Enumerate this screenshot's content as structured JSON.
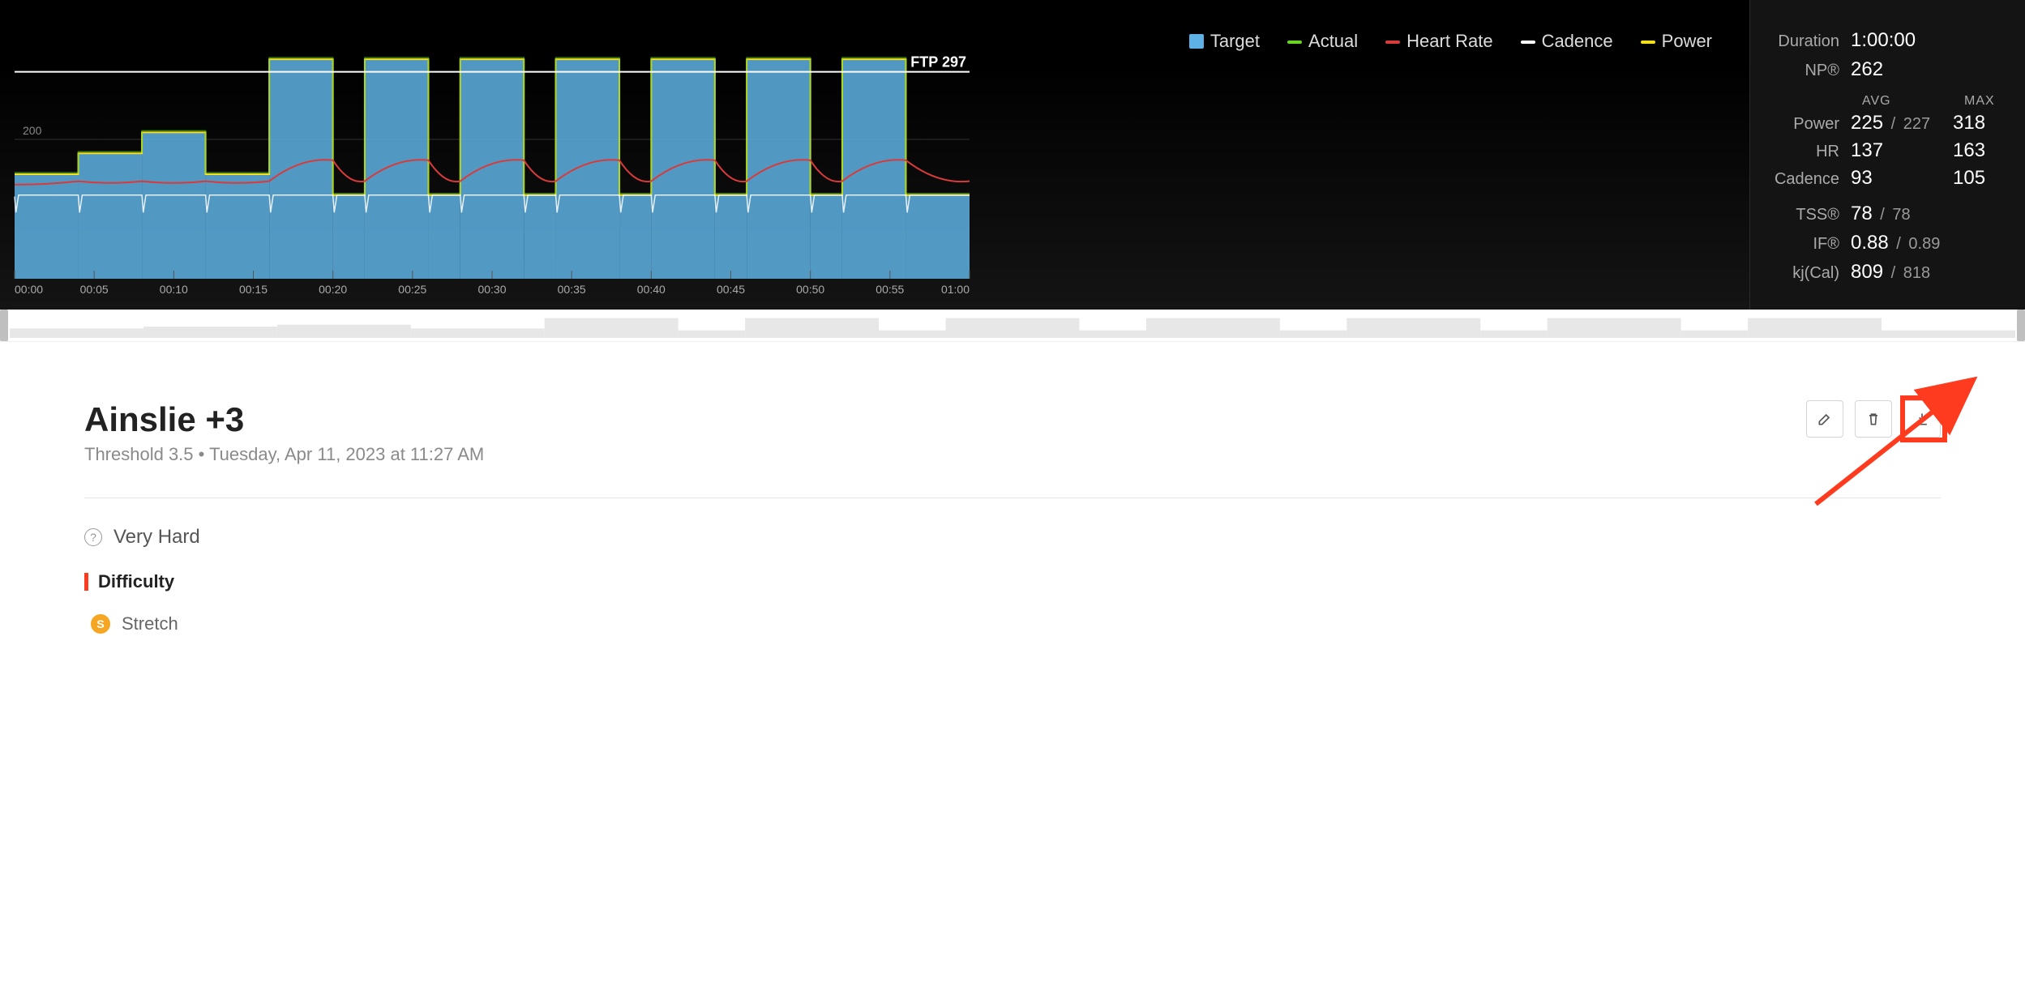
{
  "legend": {
    "target": "Target",
    "actual": "Actual",
    "hr": "Heart Rate",
    "cadence": "Cadence",
    "power": "Power"
  },
  "colors": {
    "target": "#5eb1e4",
    "actual": "#69d321",
    "hr": "#d93a3a",
    "cadence": "#ffffff",
    "power": "#f3e11a",
    "ftp_line": "#ffffff"
  },
  "ftp_label": "FTP 297",
  "summary": {
    "duration_label": "Duration",
    "duration": "1:00:00",
    "np_label": "NP®",
    "np": "262",
    "avg_header": "AVG",
    "max_header": "MAX",
    "power_label": "Power",
    "power_avg": "225",
    "power_target": "227",
    "power_max": "318",
    "hr_label": "HR",
    "hr_avg": "137",
    "hr_max": "163",
    "cad_label": "Cadence",
    "cad_avg": "93",
    "cad_max": "105",
    "tss_label": "TSS®",
    "tss_actual": "78",
    "tss_target": "78",
    "if_label": "IF®",
    "if_actual": "0.88",
    "if_target": "0.89",
    "kj_label": "kj(Cal)",
    "kj_actual": "809",
    "kj_target": "818"
  },
  "workout": {
    "title": "Ainslie +3",
    "subtitle_zone": "Threshold 3.5",
    "subtitle_sep": " • ",
    "subtitle_date": "Tuesday, Apr 11, 2023 at 11:27 AM",
    "difficulty_rating": "Very Hard",
    "section_heading": "Difficulty",
    "badge_letter": "S",
    "badge_label": "Stretch"
  },
  "chart_data": {
    "type": "area",
    "x_unit": "seconds",
    "x_range": [
      0,
      3600
    ],
    "y_unit": "watts",
    "y_range": [
      0,
      400
    ],
    "y_ticks": [
      200
    ],
    "x_ticks_labels": [
      "00:00",
      "00:05",
      "00:10",
      "00:15",
      "00:20",
      "00:25",
      "00:30",
      "00:35",
      "00:40",
      "00:45",
      "00:50",
      "00:55",
      "01:00"
    ],
    "x_ticks_seconds": [
      0,
      300,
      600,
      900,
      1200,
      1500,
      1800,
      2100,
      2400,
      2700,
      3000,
      3300,
      3600
    ],
    "ftp": 297,
    "target_intervals": [
      {
        "start": 0,
        "end": 240,
        "watts": 150
      },
      {
        "start": 240,
        "end": 480,
        "watts": 180
      },
      {
        "start": 480,
        "end": 720,
        "watts": 210
      },
      {
        "start": 720,
        "end": 960,
        "watts": 150
      },
      {
        "start": 960,
        "end": 1200,
        "watts": 315
      },
      {
        "start": 1200,
        "end": 1320,
        "watts": 120
      },
      {
        "start": 1320,
        "end": 1560,
        "watts": 315
      },
      {
        "start": 1560,
        "end": 1680,
        "watts": 120
      },
      {
        "start": 1680,
        "end": 1920,
        "watts": 315
      },
      {
        "start": 1920,
        "end": 2040,
        "watts": 120
      },
      {
        "start": 2040,
        "end": 2280,
        "watts": 315
      },
      {
        "start": 2280,
        "end": 2400,
        "watts": 120
      },
      {
        "start": 2400,
        "end": 2640,
        "watts": 315
      },
      {
        "start": 2640,
        "end": 2760,
        "watts": 120
      },
      {
        "start": 2760,
        "end": 3000,
        "watts": 315
      },
      {
        "start": 3000,
        "end": 3120,
        "watts": 120
      },
      {
        "start": 3120,
        "end": 3360,
        "watts": 315
      },
      {
        "start": 3360,
        "end": 3600,
        "watts": 120
      }
    ],
    "hr_series_bpm": {
      "start": 0,
      "end": 3600,
      "min": 110,
      "max": 163,
      "avg": 137,
      "note": "rises during each work interval, dips during recoveries"
    },
    "cadence_series_rpm": {
      "start": 0,
      "end": 3600,
      "min": 80,
      "max": 105,
      "avg": 93,
      "note": "near-flat around 90 rpm with brief dips at interval transitions"
    },
    "power_actual_note": "tracks target closely with small spikes/dips at interval starts/ends"
  }
}
